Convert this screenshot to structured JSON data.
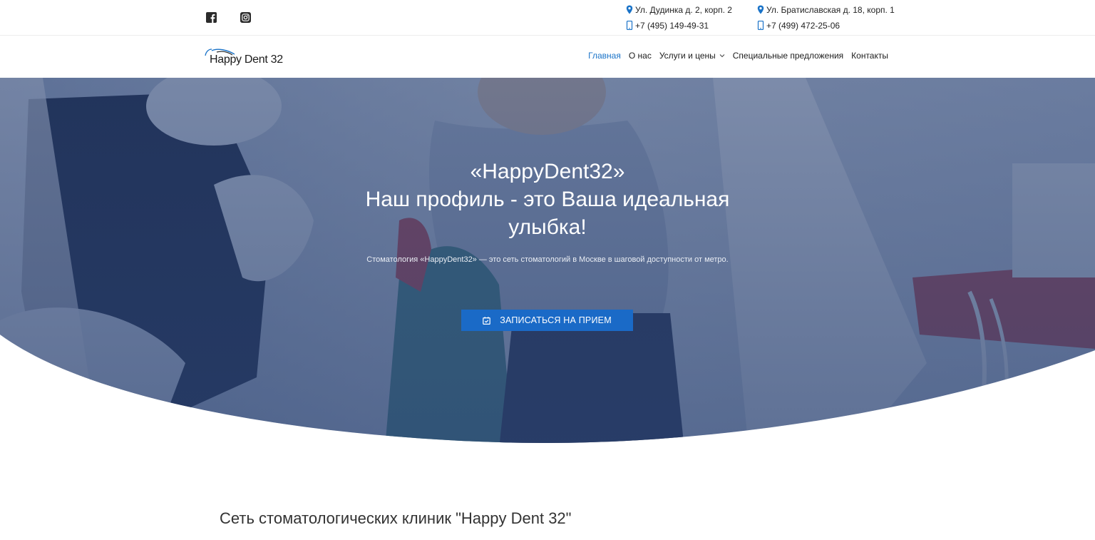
{
  "topbar": {
    "social": [
      {
        "name": "facebook-icon"
      },
      {
        "name": "instagram-icon"
      }
    ],
    "locations": [
      {
        "address": "Ул. Дудинка д. 2, корп. 2",
        "phone": "+7 (495) 149-49-31"
      },
      {
        "address": "Ул. Братиславская д. 18, корп. 1",
        "phone": "+7 (499) 472-25-06"
      }
    ]
  },
  "header": {
    "logo_text": "Happy Dent 32",
    "nav": [
      {
        "label": "Главная",
        "active": true
      },
      {
        "label": "О нас"
      },
      {
        "label": "Услуги и цены",
        "has_dropdown": true
      },
      {
        "label": "Специальные предложения"
      },
      {
        "label": "Контакты"
      }
    ]
  },
  "hero": {
    "title_line1": "«HappyDent32»",
    "title_line2": "Наш профиль - это Ваша идеальная улыбка!",
    "description": "Стоматология «HappyDent32» — это сеть стоматологий в Москве в шаговой доступности от метро.",
    "button_label": "ЗАПИСАТЬСЯ НА ПРИЕМ"
  },
  "intro": {
    "title": "Сеть стоматологических клиник \"Happy Dent 32\""
  },
  "colors": {
    "accent": "#1a73c8",
    "button": "#1a6ac7",
    "hero_overlay": "#2c4473",
    "text": "#222222"
  }
}
